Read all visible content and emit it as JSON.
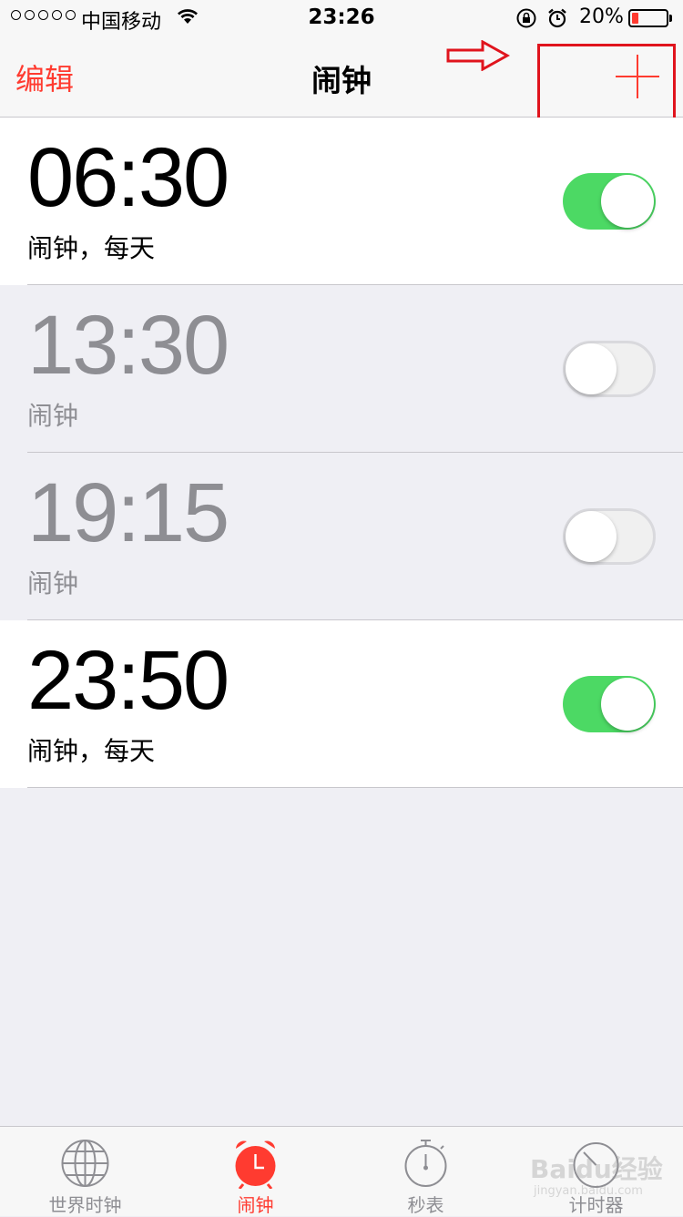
{
  "status_bar": {
    "carrier": "中国移动",
    "time": "23:26",
    "battery_pct": "20%",
    "battery_level": 0.2
  },
  "nav": {
    "edit_label": "编辑",
    "title": "闹钟"
  },
  "alarms": [
    {
      "time": "06:30",
      "label": "闹钟，每天",
      "enabled": true
    },
    {
      "time": "13:30",
      "label": "闹钟",
      "enabled": false
    },
    {
      "time": "19:15",
      "label": "闹钟",
      "enabled": false
    },
    {
      "time": "23:50",
      "label": "闹钟，每天",
      "enabled": true
    }
  ],
  "tabs": [
    {
      "label": "世界时钟",
      "icon": "globe-icon",
      "active": false
    },
    {
      "label": "闹钟",
      "icon": "alarm-clock-icon",
      "active": true
    },
    {
      "label": "秒表",
      "icon": "stopwatch-icon",
      "active": false
    },
    {
      "label": "计时器",
      "icon": "timer-icon",
      "active": false
    }
  ],
  "watermark": {
    "text": "Baidu经验",
    "sub": "jingyan.baidu.com"
  },
  "colors": {
    "accent": "#ff3b30",
    "toggle_on": "#4cd964",
    "annotation": "#e0141d"
  }
}
